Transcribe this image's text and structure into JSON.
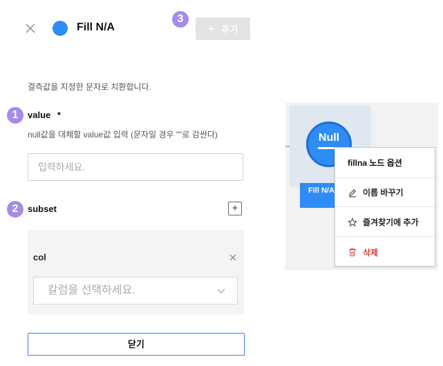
{
  "header": {
    "title": "Fill N/A",
    "add_button_label": "추가",
    "badge_3": "3"
  },
  "description": "결측값을 지정한 문자로 치환합니다.",
  "value_field": {
    "badge": "1",
    "label": "value",
    "required_mark": "*",
    "help": "null값을 대체할 value값 입력 (문자일 경우 \"\"로 감싼다)",
    "placeholder": "입력하세요."
  },
  "subset_field": {
    "badge": "2",
    "label": "subset",
    "add_label": "+",
    "col_label": "col",
    "select_placeholder": "칼럼을 선택하세요."
  },
  "close_button_label": "닫기",
  "preview": {
    "node_text": "Null",
    "node_label": "Fill N/A",
    "menu": {
      "header": "fillna 노드 옵션",
      "items": [
        {
          "label": "이름 바꾸기",
          "icon": "pencil-icon"
        },
        {
          "label": "즐겨찾기에 추가",
          "icon": "star-icon"
        },
        {
          "label": "삭제",
          "icon": "trash-icon"
        }
      ]
    }
  },
  "colors": {
    "accent_blue": "#2e8cf5",
    "badge_purple": "#a68ce6",
    "danger_red": "#e0353b"
  }
}
